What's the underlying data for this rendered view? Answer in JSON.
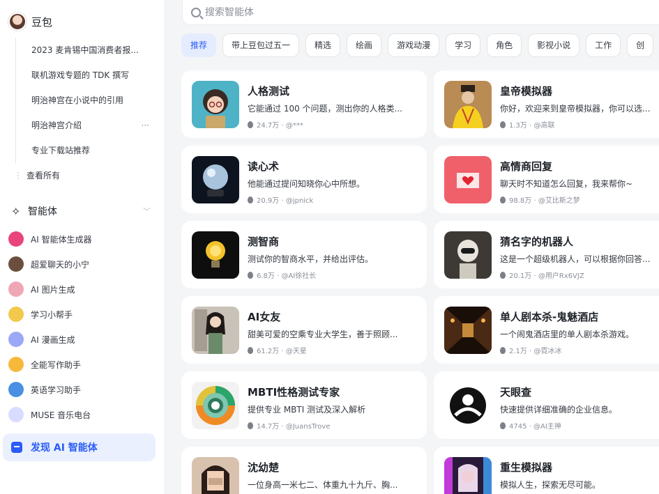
{
  "sidebar": {
    "brand": "豆包",
    "history": [
      "2023 麦肯锡中国消费者报...",
      "联机游戏专题的 TDK 撰写",
      "明治神宫在小说中的引用",
      "明治神宫介绍",
      "专业下载站推荐"
    ],
    "history_more": "···",
    "see_all": "查看所有",
    "agents_title": "智能体",
    "agents": [
      {
        "label": "AI 智能体生成器",
        "color": "#e8457a"
      },
      {
        "label": "超爱聊天的小宁",
        "color": "#6b4e3d"
      },
      {
        "label": "AI 图片生成",
        "color": "#f0a7b5"
      },
      {
        "label": "学习小帮手",
        "color": "#f2c94c"
      },
      {
        "label": "AI 漫画生成",
        "color": "#9aa8f5"
      },
      {
        "label": "全能写作助手",
        "color": "#f6b93b"
      },
      {
        "label": "英语学习助手",
        "color": "#4a90e2"
      },
      {
        "label": "MUSE 音乐电台",
        "color": "#d8dcff"
      }
    ],
    "discover": "发现 AI 智能体",
    "accent": "#2b5cf6"
  },
  "search": {
    "placeholder": "搜索智能体"
  },
  "tabs": [
    "推荐",
    "带上豆包过五一",
    "精选",
    "绘画",
    "游戏动漫",
    "学习",
    "角色",
    "影视小说",
    "工作",
    "创"
  ],
  "cards": [
    {
      "title": "人格测试",
      "desc": "它能通过 100 个问题，测出你的人格类...",
      "count": "24.7万",
      "author": "@***",
      "img": "cartoon-girl"
    },
    {
      "title": "皇帝模拟器",
      "desc": "你好，欢迎来到皇帝模拟器，你可以选...",
      "count": "1.3万",
      "author": "@高联",
      "img": "emperor"
    },
    {
      "title": "读心术",
      "desc": "他能通过提问知晓你心中所想。",
      "count": "20.9万",
      "author": "@jpnick",
      "img": "crystal-ball"
    },
    {
      "title": "高情商回复",
      "desc": "聊天时不知道怎么回复，我来帮你~",
      "count": "98.8万",
      "author": "@艾比斯之梦",
      "img": "heart-envelope"
    },
    {
      "title": "测智商",
      "desc": "测试你的智商水平，并给出评估。",
      "count": "6.8万",
      "author": "@AI徐社长",
      "img": "lightbulb"
    },
    {
      "title": "猜名字的机器人",
      "desc": "这是一个超级机器人，可以根据你回答...",
      "count": "20.1万",
      "author": "@用户Rx6VJZ",
      "img": "robot"
    },
    {
      "title": "AI女友",
      "desc": "甜美可爱的空乘专业大学生，善于照顾...",
      "count": "61.2万",
      "author": "@天星",
      "img": "girl-photo"
    },
    {
      "title": "单人剧本杀-鬼魅酒店",
      "desc": "一个闹鬼酒店里的单人剧本杀游戏。",
      "count": "2.1万",
      "author": "@霓冰冰",
      "img": "hotel-corridor"
    },
    {
      "title": "MBTI性格测试专家",
      "desc": "提供专业 MBTI 测试及深入解析",
      "count": "14.7万",
      "author": "@JuansTrove",
      "img": "mbti-wheel"
    },
    {
      "title": "天眼查",
      "desc": "快速提供详细准确的企业信息。",
      "count": "4745",
      "author": "@AI主神",
      "img": "tianyancha-logo"
    },
    {
      "title": "沈幼楚",
      "desc": "一位身高一米七二、体重九十九斤、胸...",
      "count": "",
      "author": "",
      "img": "woman-portrait"
    },
    {
      "title": "重生模拟器",
      "desc": "模拟人生，探索无尽可能。",
      "count": "",
      "author": "",
      "img": "neon-girl"
    }
  ]
}
